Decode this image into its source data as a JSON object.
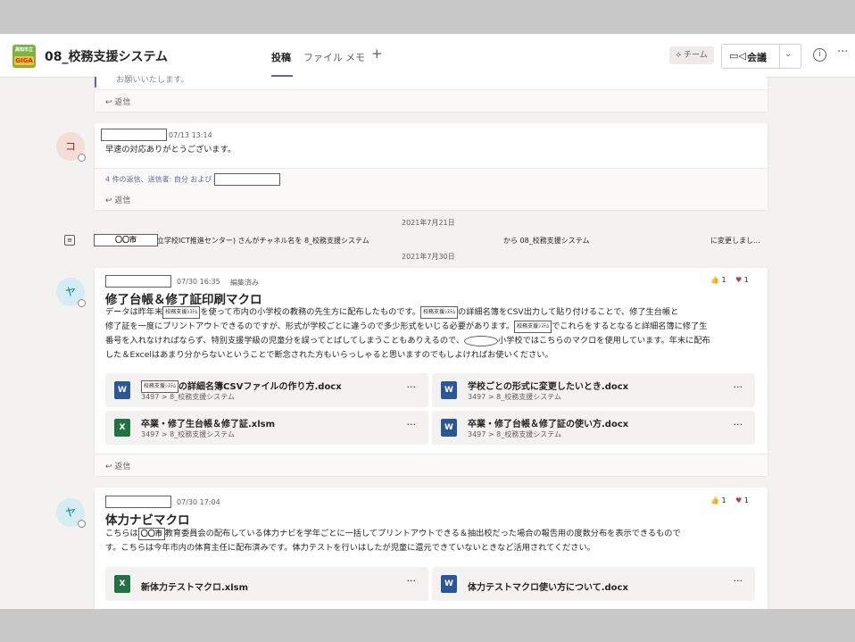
{
  "header": {
    "team_logo_top": "高知市立",
    "team_logo_bottom": "GIGA",
    "channel_title": "08_校務支援システム",
    "tabs": [
      "投稿",
      "ファイル",
      "メモ"
    ],
    "team_button": "チーム",
    "meet_button": "会議"
  },
  "posts": {
    "prev_tail": {
      "text": "お願いいたします。",
      "reply": "返信"
    },
    "thanks": {
      "avatar": "コ",
      "timestamp": "07/13 13:14",
      "text": "早速の対応ありがとうございます。",
      "replies_summary": "4 件の返信、送信者: 自分 および",
      "reply": "返信"
    },
    "date1": "2021年7月21日",
    "system": {
      "city": "〇〇市",
      "text1": "立学校ICT推進センター) さんがチャネル名を 8_校務支援システム",
      "text2": "から 08_校務支援システム",
      "text3": "に変更しまし..."
    },
    "date2": "2021年7月30日",
    "post1": {
      "avatar": "ヤ",
      "timestamp": "07/30 16:35",
      "edited": "編集済み",
      "title": "修了台帳＆修了証印刷マクロ",
      "tag": "校務支援ｼｽﾃﾑ",
      "line1a": "データは昨年末",
      "line1b": "を使って市内の小学校の教務の先生方に配布したものです。",
      "line1c": "の詳細名簿をCSV出力して貼り付けることで、修了生台帳と",
      "line2a": "修了証を一度にプリントアウトできるのですが、形式が学校ごとに違うので多少形式をいじる必要があります。",
      "line2b": "でこれらをするとなると詳細名簿に修了生",
      "line3a": "番号を入れなければならず、特別支援学級の児童分を誤ってとばしてしまうこともありえるので、",
      "line3b": "小学校ではこちらのマクロを使用しています。年末に配布",
      "line4": "した＆Excelはあまり分からないということで断念された方もいらっしゃると思いますのでもしよければお使いください。",
      "like_count": "1",
      "heart_count": "1",
      "files": [
        {
          "name": "の詳細名簿CSVファイルの作り方.docx",
          "path": "3497 > 8_校務支援システム",
          "type": "word"
        },
        {
          "name": "学校ごとの形式に変更したいとき.docx",
          "path": "3497 > 8_校務支援システム",
          "type": "word"
        },
        {
          "name": "卒業・修了生台帳＆修了証.xlsm",
          "path": "3497 > 8_校務支援システム",
          "type": "excel"
        },
        {
          "name": "卒業・修了台帳＆修了証の使い方.docx",
          "path": "3497 > 8_校務支援システム",
          "type": "word"
        }
      ],
      "reply": "返信"
    },
    "post2": {
      "avatar": "ヤ",
      "timestamp": "07/30 17:04",
      "title": "体力ナビマクロ",
      "city": "〇〇市",
      "line1a": "こちらは",
      "line1b": "教育委員会の配布している体力ナビを学年ごとに一括してプリントアウトできる＆抽出校だった場合の報告用の度数分布を表示できるもので",
      "line2": "す。こちらは今年市内の体育主任に配布済みです。体力テストを行いはしたが児童に還元できていないときなど活用されてください。",
      "like_count": "1",
      "heart_count": "1",
      "files": [
        {
          "name": "新体力テストマクロ.xlsm",
          "type": "excel"
        },
        {
          "name": "体力テストマクロ使い方について.docx",
          "type": "word"
        }
      ]
    }
  },
  "colors": {
    "accent": "#6264a7",
    "word": "#2b579a",
    "excel": "#217346"
  }
}
